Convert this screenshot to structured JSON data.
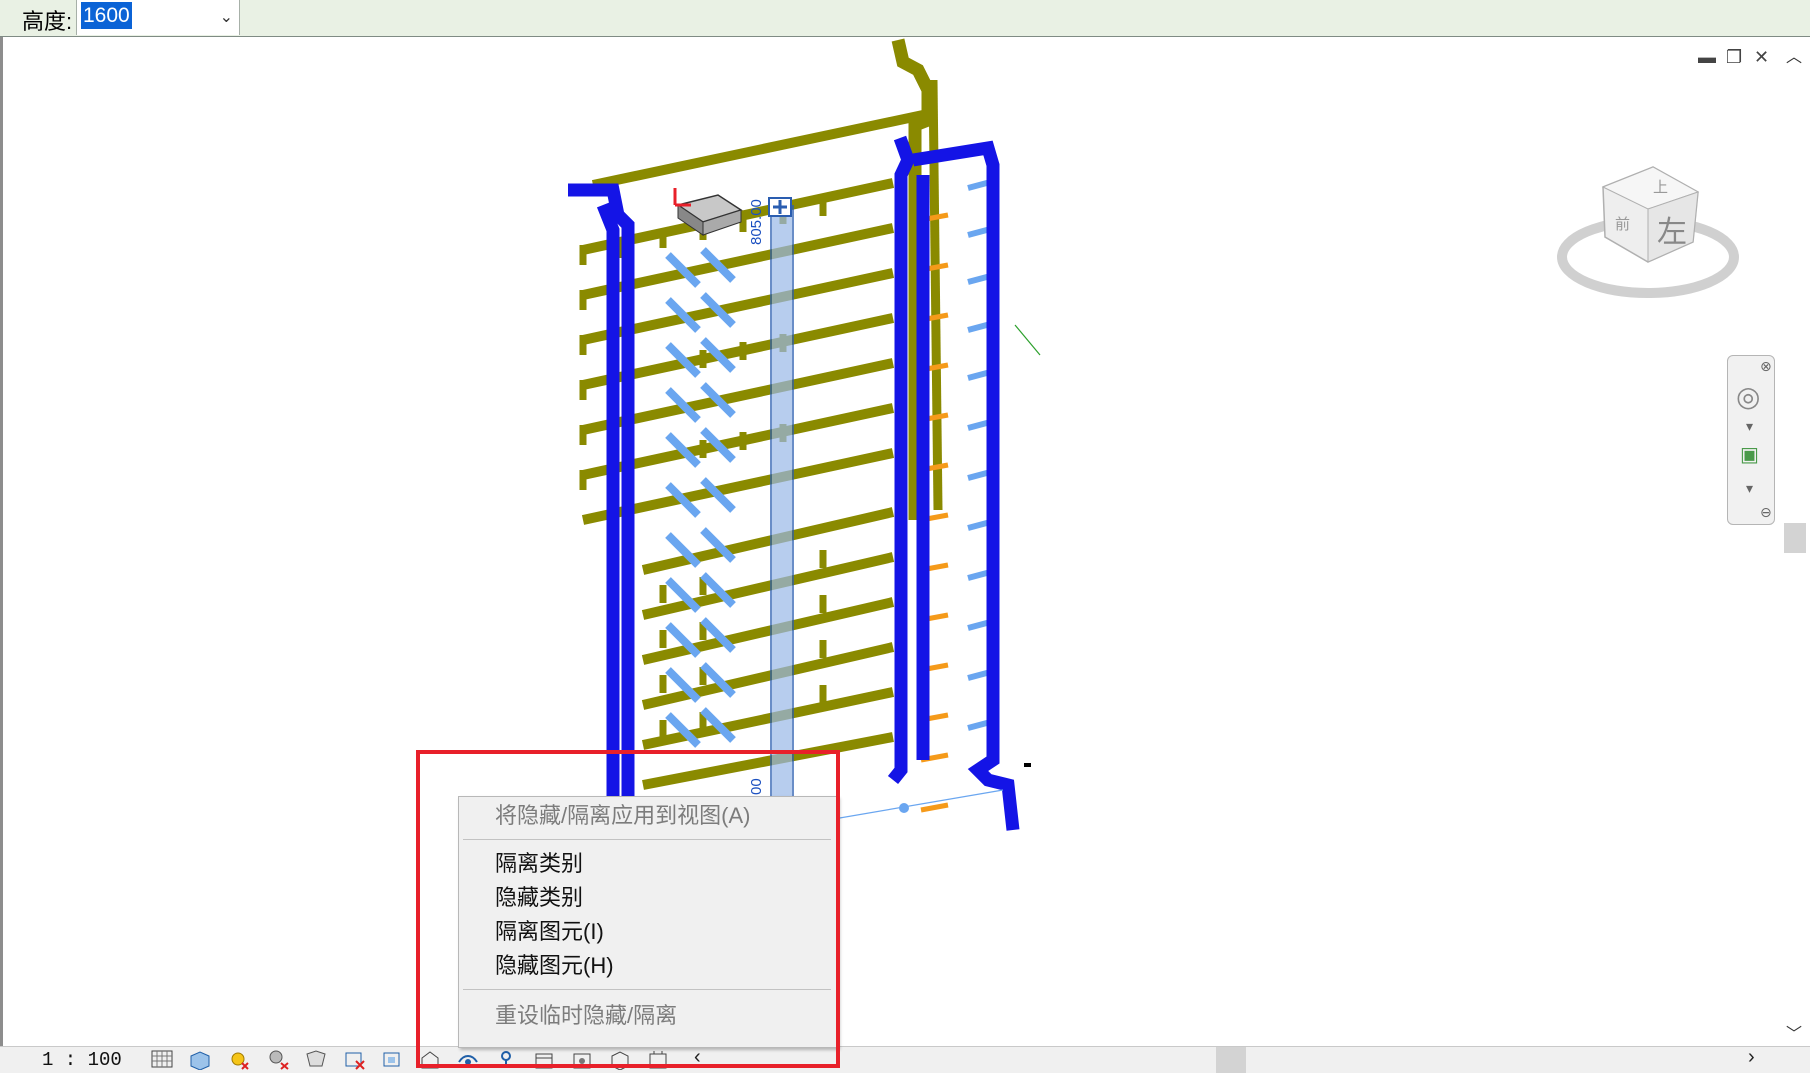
{
  "options_bar": {
    "height_label": "高度:",
    "height_value": "1600"
  },
  "window_controls": {
    "minimize_glyph": "▬",
    "restore_glyph": "❐",
    "close_glyph": "✕"
  },
  "viewcube": {
    "face_left": "左",
    "face_top": "上",
    "face_front": "前"
  },
  "model_annotations": {
    "dimension_upper": "805.00",
    "dimension_lower": "00"
  },
  "status_bar": {
    "scale": "1 : 100",
    "left_arrow": "‹",
    "right_arrow": "›"
  },
  "scrollbar": {
    "up_arrow": "︿",
    "down_arrow": "﹀"
  },
  "context_menu": {
    "items": [
      {
        "label": "将隐藏/隔离应用到视图(A)",
        "enabled": false
      },
      {
        "label": "隔离类别",
        "enabled": true
      },
      {
        "label": "隐藏类别",
        "enabled": true
      },
      {
        "label": "隔离图元(I)",
        "enabled": true
      },
      {
        "label": "隐藏图元(H)",
        "enabled": true
      },
      {
        "label": "重设临时隐藏/隔离",
        "enabled": false
      }
    ]
  },
  "colors": {
    "pipe_yellow": "#8a8a00",
    "pipe_blue": "#1414e6",
    "pipe_lightblue": "#6aa6f0",
    "fitting_orange": "#f59a1a",
    "highlight_red": "#e8202a",
    "options_bar_bg": "#e9f1e4"
  }
}
